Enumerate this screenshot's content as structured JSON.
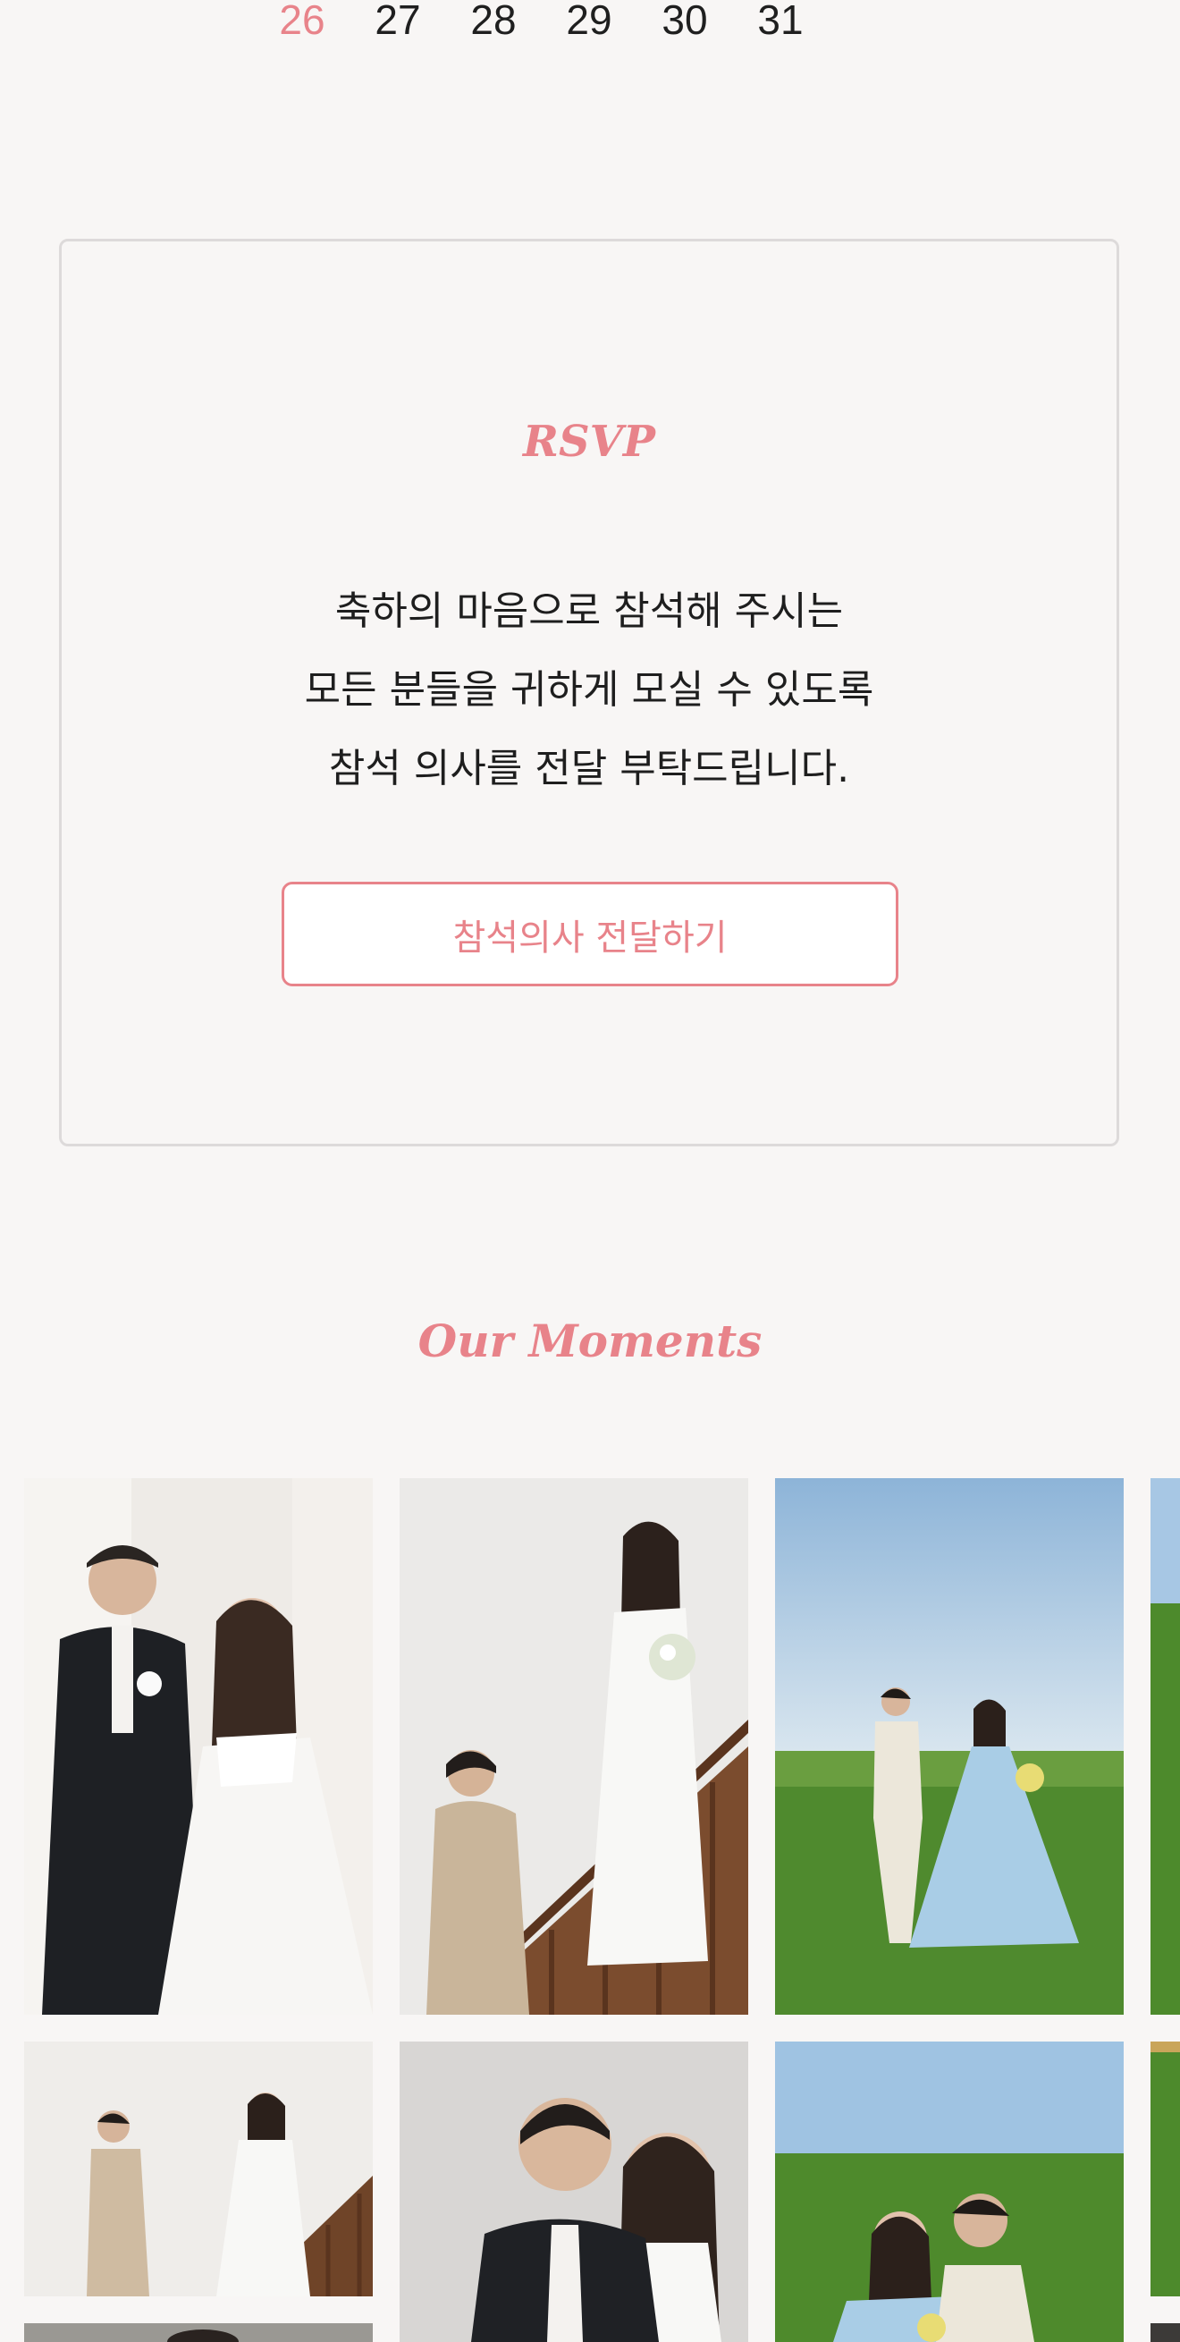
{
  "calendar": {
    "days": [
      "26",
      "27",
      "28",
      "29",
      "30",
      "31"
    ]
  },
  "rsvp": {
    "title": "RSVP",
    "lines": [
      "축하의 마음으로 참석해 주시는",
      "모든 분들을 귀하게 모실 수 있도록",
      "참석 의사를 전달 부탁드립니다."
    ],
    "button_label": "참석의사 전달하기"
  },
  "moments": {
    "title": "Our Moments"
  },
  "colors": {
    "accent": "#e8838a",
    "background": "#f8f6f5",
    "border": "#dddada"
  }
}
